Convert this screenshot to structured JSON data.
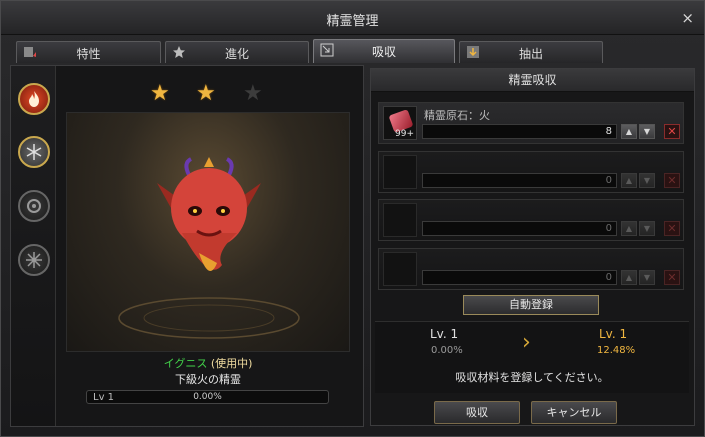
{
  "window": {
    "title": "精霊管理",
    "close_label": "×"
  },
  "tabs": [
    {
      "label": "特性",
      "icon": "trait-icon"
    },
    {
      "label": "進化",
      "icon": "star-icon"
    },
    {
      "label": "吸収",
      "icon": "absorb-icon",
      "active": true
    },
    {
      "label": "抽出",
      "icon": "extract-icon"
    }
  ],
  "elements": [
    {
      "name": "fire",
      "selected": true
    },
    {
      "name": "ice",
      "selected": false
    },
    {
      "name": "wind",
      "selected": false
    },
    {
      "name": "light",
      "selected": false
    }
  ],
  "spirit": {
    "stars": {
      "filled": 2,
      "total": 3
    },
    "name": "イグニス",
    "status": "(使用中)",
    "description": "下級火の精霊",
    "level_label": "Lv 1",
    "exp_percent": "0.00%"
  },
  "absorb_panel": {
    "title": "精霊吸収",
    "slots": [
      {
        "item_name": "精霊原石：火",
        "count": "99+",
        "quantity": "8",
        "filled": true
      },
      {
        "item_name": "",
        "count": "",
        "quantity": "0",
        "filled": false
      },
      {
        "item_name": "",
        "count": "",
        "quantity": "0",
        "filled": false
      },
      {
        "item_name": "",
        "count": "",
        "quantity": "0",
        "filled": false
      }
    ],
    "up_symbol": "▲",
    "down_symbol": "▼",
    "remove_symbol": "✕",
    "auto_register_label": "自動登録",
    "current_level": "Lv. 1",
    "current_percent": "0.00%",
    "arrow": "›",
    "next_level": "Lv. 1",
    "next_percent": "12.48%",
    "message": "吸収材料を登録してください。"
  },
  "buttons": {
    "absorb": "吸収",
    "cancel": "キャンセル"
  },
  "colors": {
    "accent": "#f0b640",
    "name_green": "#43d24a",
    "remove_red": "#e04646"
  }
}
